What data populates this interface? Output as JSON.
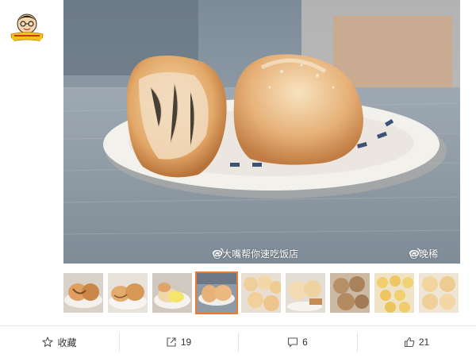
{
  "author": {
    "avatar_icon": "cartoon-avatar-icon"
  },
  "photo": {
    "watermark_left": "@大嘴帮你速吃饭店",
    "watermark_right": "@晚稀"
  },
  "thumbnails": {
    "count": 9,
    "selected_index": 3
  },
  "actions": {
    "favorite": {
      "label": "收藏",
      "icon": "star-icon"
    },
    "repost": {
      "count": "19",
      "icon": "share-arrow-icon"
    },
    "comment": {
      "count": "6",
      "icon": "comment-icon"
    },
    "like": {
      "count": "21",
      "icon": "thumbs-up-icon"
    }
  },
  "colors": {
    "active_thumb_border": "#f07a2b",
    "text": "#333333"
  }
}
